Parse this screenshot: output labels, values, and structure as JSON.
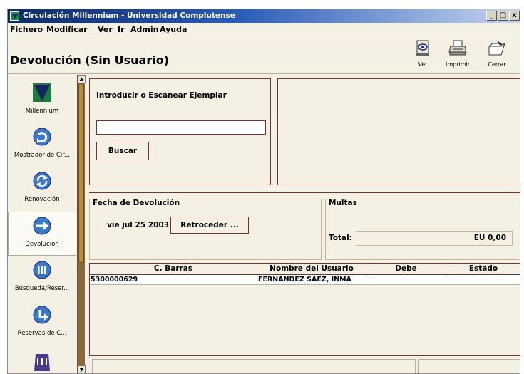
{
  "window": {
    "title": "Circulación Millennium - Universidad Complutense"
  },
  "window_controls": {
    "minimize": "_",
    "maximize": "□",
    "close": "x"
  },
  "menu": [
    "Fichero",
    "Modificar",
    "Ver",
    "Ir",
    "Admin",
    "Ayuda"
  ],
  "page": {
    "title": "Devolución (Sin Usuario)"
  },
  "toolbar": {
    "view_label": "Ver",
    "print_label": "Imprimir",
    "close_label": "Cerrar"
  },
  "sidebar": {
    "items": [
      {
        "label": "Millennium",
        "icon": "millennium-logo-icon"
      },
      {
        "label": "Mostrador de Cir...",
        "icon": "circulation-desk-icon"
      },
      {
        "label": "Renovación",
        "icon": "renewal-icon"
      },
      {
        "label": "Devolución",
        "icon": "checkin-arrow-icon",
        "active": true
      },
      {
        "label": "Búsqueda/Reser...",
        "icon": "search-hold-icon"
      },
      {
        "label": "Reservas de C...",
        "icon": "holds-icon"
      }
    ]
  },
  "scan": {
    "prompt": "Introducir o Escanear Ejemplar",
    "value": "",
    "button": "Buscar"
  },
  "return_date": {
    "title": "Fecha de Devolución",
    "value": "vie jul 25 2003",
    "button": "Retroceder ..."
  },
  "fines": {
    "title": "Multas",
    "total_label": "Total:",
    "total_value": "EU 0,00"
  },
  "table": {
    "columns": [
      "C. Barras",
      "Nombre del Usuario",
      "Debe",
      "Estado"
    ],
    "rows": [
      {
        "barcode": "5300000629",
        "patron": "FERNANDEZ SAEZ, INMA",
        "owed": "",
        "status": ""
      }
    ]
  },
  "colors": {
    "title_bar": "#0b2a6b",
    "panel_border": "#7a2e2e",
    "background": "#f4f0e4",
    "scroll_thumb": "#b88a3e"
  }
}
